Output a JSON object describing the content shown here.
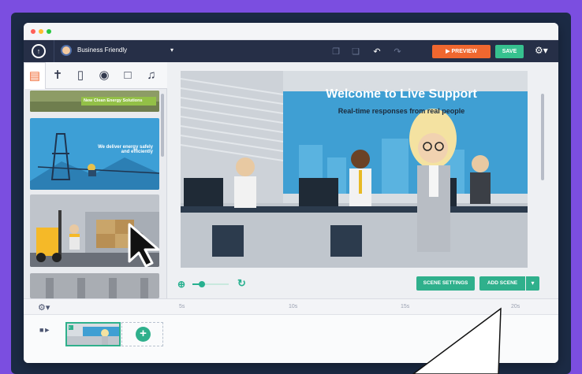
{
  "toolbar": {
    "theme_label": "Business Friendly",
    "preview_label": "PREVIEW",
    "save_label": "SAVE"
  },
  "library": {
    "tabs": [
      "image-icon",
      "character-icon",
      "device-icon",
      "speech-bubble-icon",
      "chart-icon",
      "music-icon"
    ],
    "thumbs": [
      {
        "caption": "New Clean Energy Solutions"
      },
      {
        "caption": "We deliver energy safely and efficiently"
      }
    ]
  },
  "scene": {
    "title": "Welcome to Live Support",
    "subtitle": "Real-time responses from real people"
  },
  "canvas_controls": {
    "scene_settings_label": "SCENE SETTINGS",
    "add_scene_label": "ADD SCENE",
    "zoom_level": 0.25
  },
  "timeline": {
    "ticks": [
      "5s",
      "10s",
      "15s",
      "20s"
    ],
    "scene_number": "1"
  },
  "colors": {
    "background": "#7b4ee0",
    "toolbar": "#262f47",
    "accent_green": "#2fb08c",
    "accent_orange": "#f0672f"
  }
}
